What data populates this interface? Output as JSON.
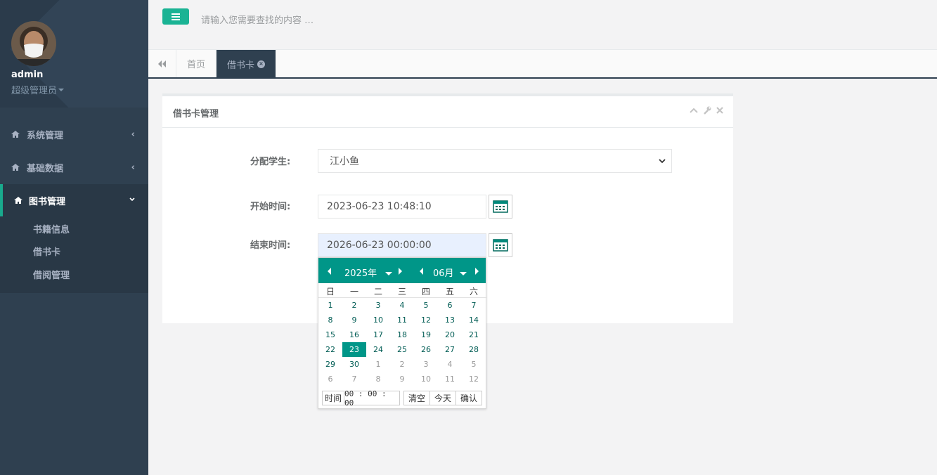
{
  "profile": {
    "name": "admin",
    "role": "超级管理员"
  },
  "sidebar": {
    "items": [
      {
        "label": "系统管理"
      },
      {
        "label": "基础数据"
      },
      {
        "label": "图书管理"
      }
    ],
    "subitems": [
      {
        "label": "书籍信息"
      },
      {
        "label": "借书卡"
      },
      {
        "label": "借阅管理"
      }
    ]
  },
  "topbar": {
    "search_placeholder": "请输入您需要查找的内容 …"
  },
  "tabs": [
    {
      "label": "首页"
    },
    {
      "label": "借书卡"
    }
  ],
  "panel": {
    "title": "借书卡管理",
    "fields": {
      "student_label": "分配学生:",
      "student_value": "江小鱼",
      "start_label": "开始时间:",
      "start_value": "2023-06-23 10:48:10",
      "end_label": "结束时间:",
      "end_value": "2026-06-23 00:00:00"
    }
  },
  "picker": {
    "year": "2025年",
    "month": "06月",
    "weekdays": [
      "日",
      "一",
      "二",
      "三",
      "四",
      "五",
      "六"
    ],
    "days": [
      [
        "1",
        "2",
        "3",
        "4",
        "5",
        "6",
        "7"
      ],
      [
        "8",
        "9",
        "10",
        "11",
        "12",
        "13",
        "14"
      ],
      [
        "15",
        "16",
        "17",
        "18",
        "19",
        "20",
        "21"
      ],
      [
        "22",
        "23",
        "24",
        "25",
        "26",
        "27",
        "28"
      ],
      [
        "29",
        "30",
        "1",
        "2",
        "3",
        "4",
        "5"
      ],
      [
        "6",
        "7",
        "8",
        "9",
        "10",
        "11",
        "12"
      ]
    ],
    "selected_day": "23",
    "time_label": "时间",
    "time_value": "00 : 00 : 00",
    "clear_label": "清空",
    "today_label": "今天",
    "confirm_label": "确认"
  },
  "colors": {
    "accent": "#1ab394",
    "picker": "#009688",
    "sidebar": "#2f4050"
  }
}
